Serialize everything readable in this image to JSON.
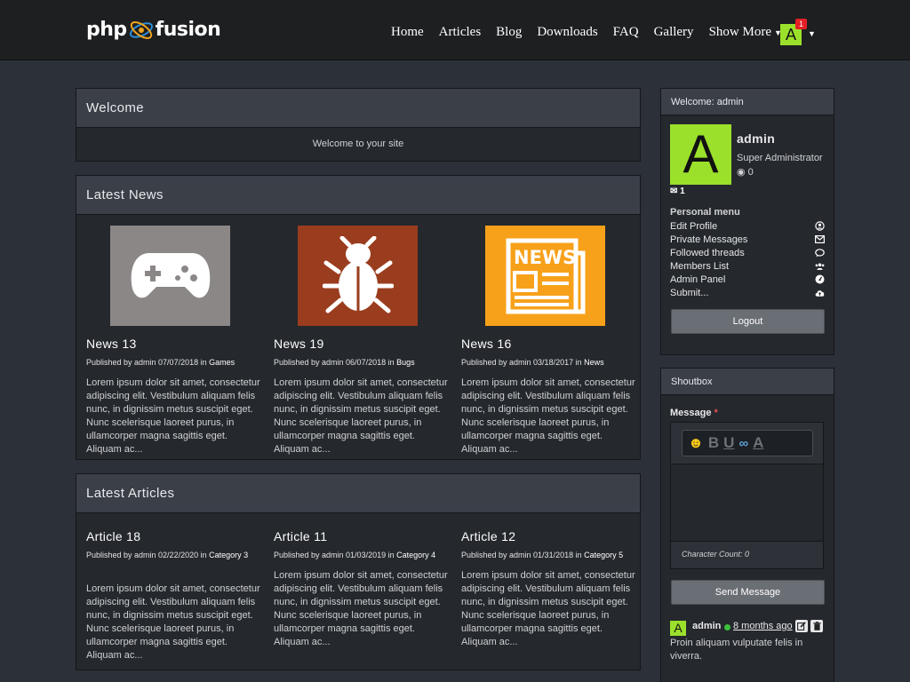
{
  "brand": {
    "left": "php",
    "right": "fusion"
  },
  "nav": {
    "items": [
      "Home",
      "Articles",
      "Blog",
      "Downloads",
      "FAQ",
      "Gallery",
      "Show More"
    ],
    "avatar_letter": "A",
    "badge": "1"
  },
  "welcome": {
    "title": "Welcome",
    "body": "Welcome to your site"
  },
  "news": {
    "title": "Latest News",
    "items": [
      {
        "title": "News 13",
        "by": "Published by admin 07/07/2018 in ",
        "category": "Games",
        "icon": "gamepad-icon",
        "color": "#8c8787",
        "text": "Lorem ipsum dolor sit amet, consectetur adipiscing elit. Vestibulum aliquam felis nunc, in dignissim metus suscipit eget. Nunc scelerisque laoreet purus, in ullamcorper magna sagittis eget. Aliquam ac..."
      },
      {
        "title": "News 19",
        "by": "Published by admin 06/07/2018 in ",
        "category": "Bugs",
        "icon": "bug-icon",
        "color": "#9a3d1e",
        "text": "Lorem ipsum dolor sit amet, consectetur adipiscing elit. Vestibulum aliquam felis nunc, in dignissim metus suscipit eget. Nunc scelerisque laoreet purus, in ullamcorper magna sagittis eget. Aliquam ac..."
      },
      {
        "title": "News 16",
        "by": "Published by admin 03/18/2017 in ",
        "category": "News",
        "icon": "newspaper-icon",
        "color": "#f7a11a",
        "text": "Lorem ipsum dolor sit amet, consectetur adipiscing elit. Vestibulum aliquam felis nunc, in dignissim metus suscipit eget. Nunc scelerisque laoreet purus, in ullamcorper magna sagittis eget. Aliquam ac..."
      }
    ]
  },
  "articles": {
    "title": "Latest Articles",
    "items": [
      {
        "title": "Article 18",
        "by": "Published by admin 02/22/2020 in ",
        "category": "Category 3",
        "text": "Lorem ipsum dolor sit amet, consectetur adipiscing elit. Vestibulum aliquam felis nunc, in dignissim metus suscipit eget. Nunc scelerisque laoreet purus, in ullamcorper magna sagittis eget. Aliquam ac..."
      },
      {
        "title": "Article 11",
        "by": "Published by admin 01/03/2019 in ",
        "category": "Category 4",
        "text": "Lorem ipsum dolor sit amet, consectetur adipiscing elit. Vestibulum aliquam felis nunc, in dignissim metus suscipit eget. Nunc scelerisque laoreet purus, in ullamcorper magna sagittis eget. Aliquam ac..."
      },
      {
        "title": "Article 12",
        "by": "Published by admin 01/31/2018 in ",
        "category": "Category 5",
        "text": "Lorem ipsum dolor sit amet, consectetur adipiscing elit. Vestibulum aliquam felis nunc, in dignissim metus suscipit eget. Nunc scelerisque laoreet purus, in ullamcorper magna sagittis eget. Aliquam ac..."
      }
    ]
  },
  "user_panel": {
    "title": "Welcome: admin",
    "avatar_letter": "A",
    "name": "admin",
    "role": "Super Administrator",
    "points": "0",
    "messages": "1",
    "menu_title": "Personal menu",
    "menu": [
      {
        "label": "Edit Profile",
        "icon": "user-circle-icon"
      },
      {
        "label": "Private Messages",
        "icon": "envelope-icon"
      },
      {
        "label": "Followed threads",
        "icon": "chat-bubble-icon"
      },
      {
        "label": "Members List",
        "icon": "users-icon"
      },
      {
        "label": "Admin Panel",
        "icon": "dashboard-icon"
      },
      {
        "label": "Submit...",
        "icon": "cloud-upload-icon"
      }
    ],
    "logout": "Logout"
  },
  "shoutbox": {
    "title": "Shoutbox",
    "message_label": "Message",
    "required_mark": "*",
    "char_count": "Character Count: 0",
    "send": "Send Message",
    "shout": {
      "avatar_letter": "A",
      "name": "admin",
      "time": "8 months ago",
      "text": "Proin aliquam vulputate felis in viverra."
    }
  },
  "colors": {
    "accent_green": "#9be02b",
    "badge_red": "#e41f25",
    "panel_bg": "#25282d",
    "panel_head": "#3a3f48"
  }
}
